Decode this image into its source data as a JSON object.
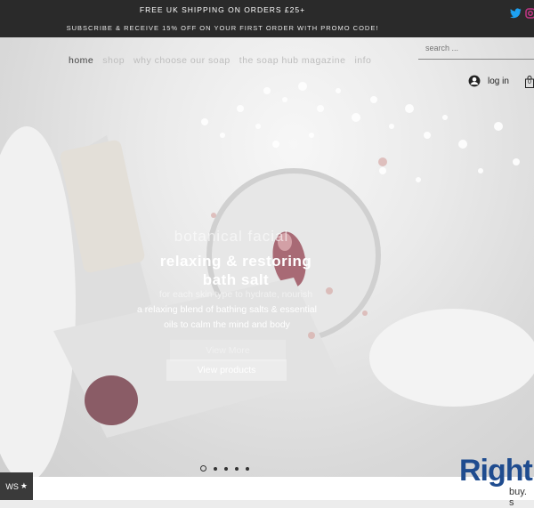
{
  "announcement": {
    "line1": "FREE UK SHIPPING ON ORDERS £25+",
    "line2": "SUBSCRIBE & RECEIVE 15% OFF ON YOUR FIRST ORDER WITH PROMO CODE!"
  },
  "social": {
    "icons": [
      "twitter-icon",
      "instagram-icon"
    ]
  },
  "nav": {
    "items": [
      "home",
      "shop",
      "why choose our soap",
      "the soap hub magazine",
      "info"
    ],
    "active": "home"
  },
  "search": {
    "placeholder": "search ..."
  },
  "account": {
    "login_label": "log in",
    "cart_count": "0"
  },
  "slide": {
    "faded_title": "botanical facial",
    "title_line1": "relaxing & restoring",
    "title_line2": "bath salt",
    "faded_description": "for each skin type to hydrate, nourish",
    "description_line1": "a relaxing blend of bathing salts & essential",
    "description_line2": "oils to calm the mind and body",
    "faded_button": "View More",
    "button": "View products"
  },
  "slider": {
    "total": 5,
    "current": 1
  },
  "reviews_badge": {
    "text": "WS",
    "icon": "star-icon"
  },
  "brand": {
    "name": "Right",
    "tagline": "buy. s"
  },
  "colors": {
    "topbar": "#2a2a2a",
    "brand_blue": "#1f4c8f",
    "twitter_blue": "#1da1f2",
    "instagram_pink": "#c13584"
  }
}
